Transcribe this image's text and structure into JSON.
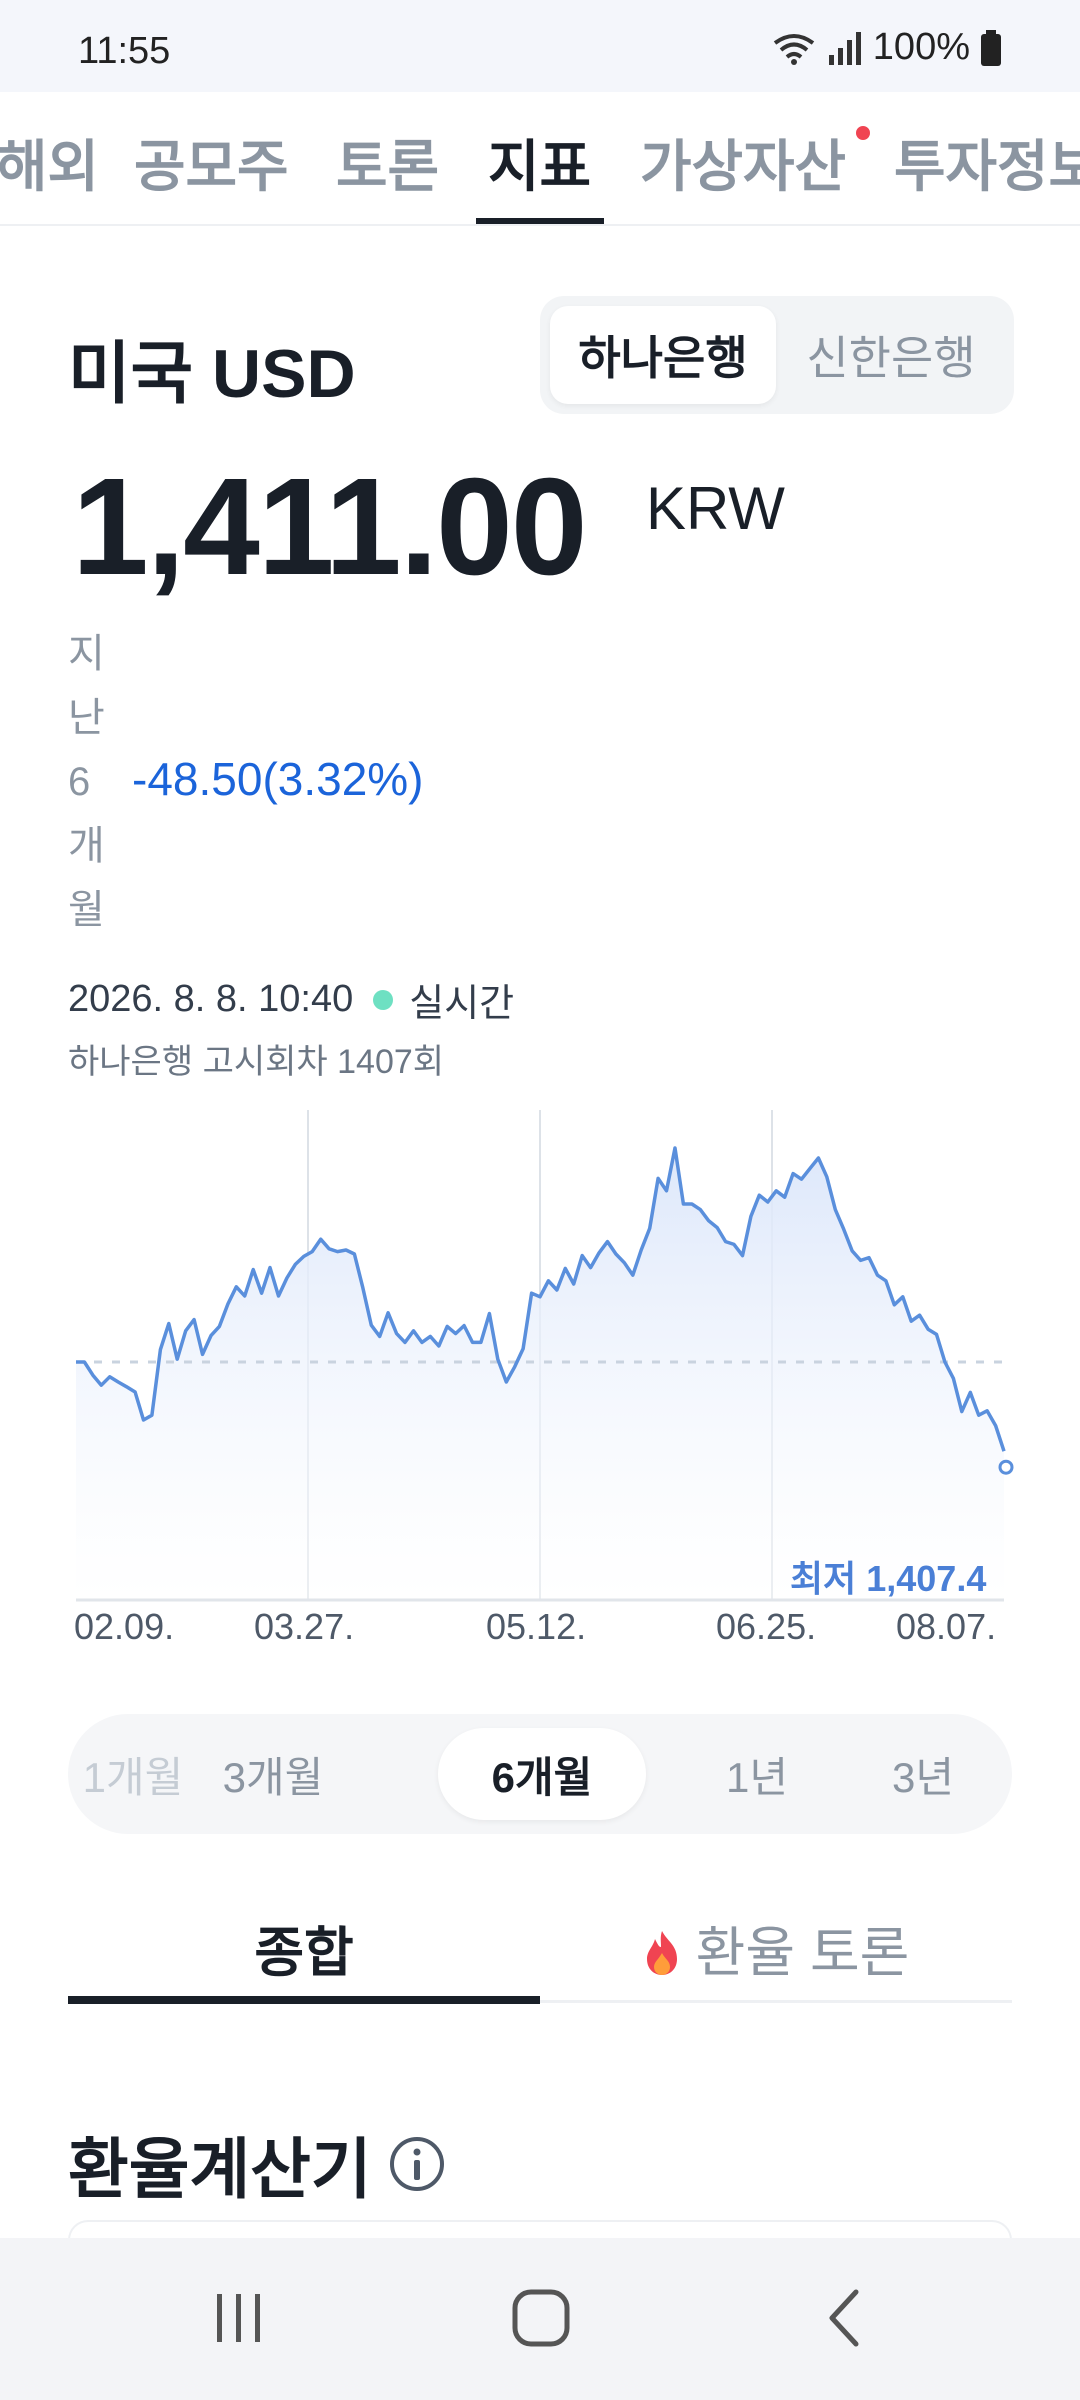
{
  "status": {
    "time": "11:55",
    "battery": "100%"
  },
  "tabs": [
    {
      "label": "해외"
    },
    {
      "label": "공모주"
    },
    {
      "label": "토론"
    },
    {
      "label": "지표"
    },
    {
      "label": "가상자산"
    },
    {
      "label": "투자정보"
    }
  ],
  "header": {
    "title": "미국 USD",
    "bank_options": [
      "하나은행",
      "신한은행"
    ]
  },
  "price": {
    "value": "1,411.00",
    "unit": "KRW"
  },
  "change": {
    "period": "지난 6개월",
    "amount": "-48.50",
    "percent": "(3.32%)"
  },
  "timestamp": {
    "date": "2026. 8. 8. 10:40",
    "live": "실시간"
  },
  "notice": "하나은행 고시회차 1407회",
  "chart_data": {
    "type": "area",
    "x_ticks": [
      "02.09.",
      "03.27.",
      "05.12.",
      "06.25.",
      "08.07."
    ],
    "values": [
      1459.5,
      1459.5,
      1456.2,
      1453.7,
      1455.8,
      1454.5,
      1453.3,
      1452.0,
      1445.0,
      1446.2,
      1462.6,
      1469.1,
      1460.2,
      1467.3,
      1470.1,
      1461.4,
      1466.1,
      1468.4,
      1474.0,
      1478.3,
      1476.0,
      1482.6,
      1476.7,
      1483.1,
      1476.0,
      1480.5,
      1483.9,
      1485.9,
      1487.1,
      1490.2,
      1487.8,
      1487.1,
      1487.5,
      1486.5,
      1478.1,
      1468.7,
      1465.9,
      1471.8,
      1466.6,
      1464.4,
      1467.3,
      1464.4,
      1465.9,
      1463.5,
      1468.4,
      1466.6,
      1468.6,
      1464.4,
      1464.4,
      1471.6,
      1460.2,
      1454.5,
      1458.3,
      1462.8,
      1476.7,
      1475.8,
      1479.8,
      1477.5,
      1482.9,
      1479.0,
      1486.1,
      1483.1,
      1486.8,
      1489.6,
      1486.5,
      1484.3,
      1481.2,
      1487.5,
      1492.9,
      1505.4,
      1502.3,
      1513.0,
      1499.0,
      1499.0,
      1497.6,
      1494.8,
      1493.1,
      1489.6,
      1488.9,
      1486.1,
      1495.9,
      1501.2,
      1499.5,
      1502.3,
      1500.7,
      1506.6,
      1505.2,
      1507.9,
      1510.5,
      1505.8,
      1497.6,
      1492.7,
      1487.3,
      1484.9,
      1485.6,
      1481.2,
      1479.8,
      1473.8,
      1475.8,
      1469.7,
      1471.2,
      1467.7,
      1466.4,
      1459.5,
      1455.4,
      1447.1,
      1451.9,
      1446.2,
      1447.3,
      1443.6,
      1437.2
    ],
    "average": 1459.5,
    "min_label": "최저 1,407.4",
    "ylim": [
      1400,
      1520
    ],
    "grid": "vertical lines at x ticks",
    "colors": {
      "line": "#5a8fdc",
      "fill": "#e3ecfb",
      "average": "#c9d3df"
    }
  },
  "ranges": [
    {
      "label": "1개월"
    },
    {
      "label": "3개월"
    },
    {
      "label": "6개월"
    },
    {
      "label": "1년"
    },
    {
      "label": "3년"
    }
  ],
  "sub_tabs": [
    "종합",
    "환율 토론"
  ],
  "section": {
    "title": "환율계산기"
  },
  "colors": {
    "accent_blue": "#1b64da",
    "live_green": "#6ee0c2",
    "badge_red": "#f04452",
    "text": "#191f28",
    "muted": "#8b95a1"
  }
}
